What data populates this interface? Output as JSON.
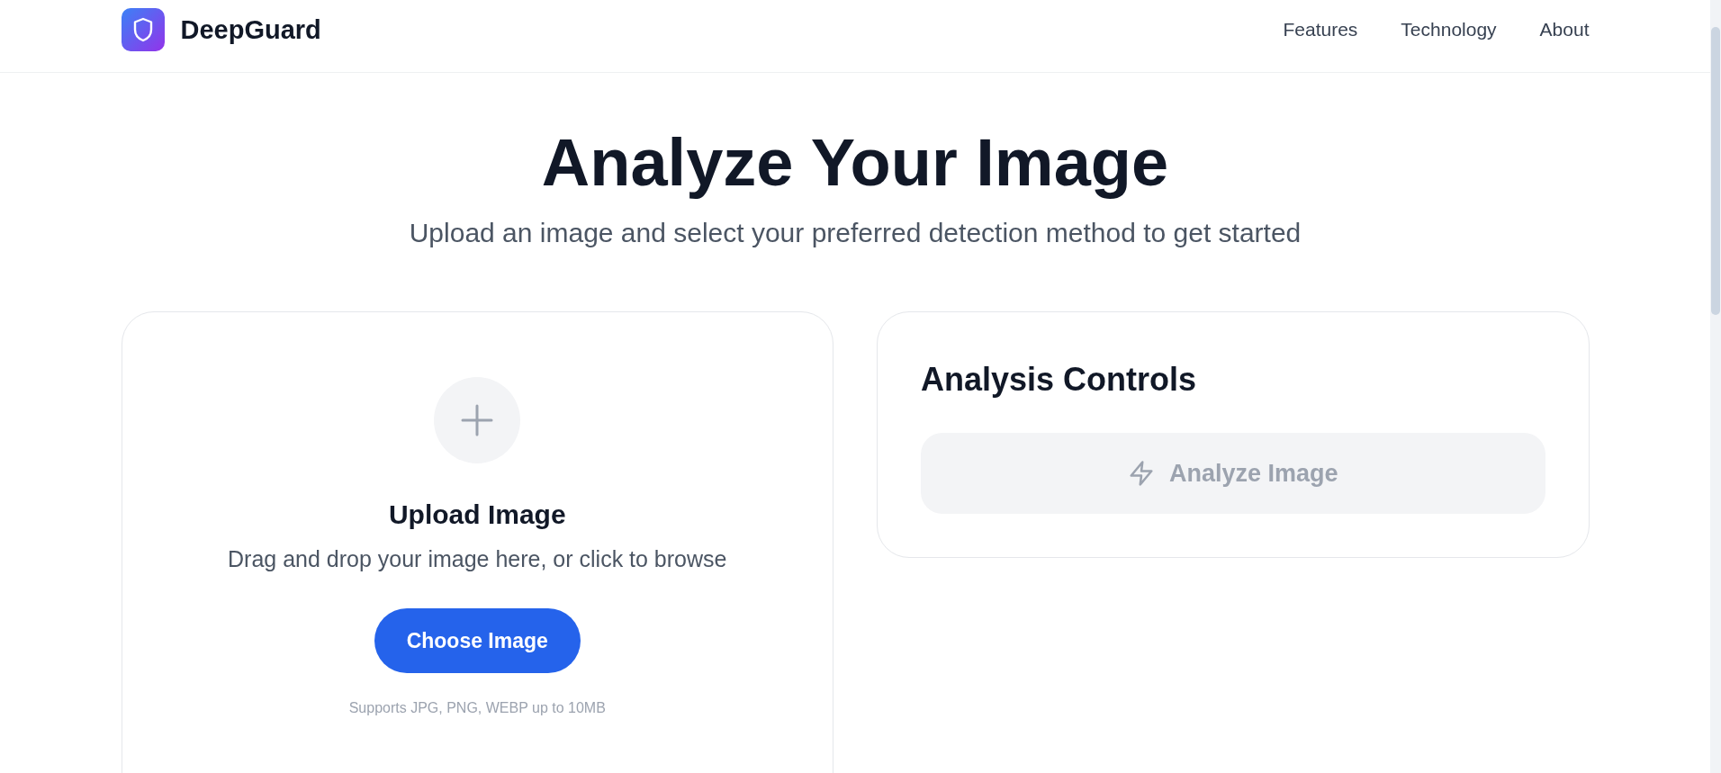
{
  "header": {
    "brand": "DeepGuard",
    "nav": [
      "Features",
      "Technology",
      "About"
    ]
  },
  "hero": {
    "title": "Analyze Your Image",
    "subtitle": "Upload an image and select your preferred detection method to get started"
  },
  "upload_card": {
    "title": "Upload Image",
    "hint": "Drag and drop your image here, or click to browse",
    "button": "Choose Image",
    "note": "Supports JPG, PNG, WEBP up to 10MB"
  },
  "controls_card": {
    "title": "Analysis Controls",
    "button": {
      "label": "Analyze Image",
      "disabled": true
    }
  }
}
